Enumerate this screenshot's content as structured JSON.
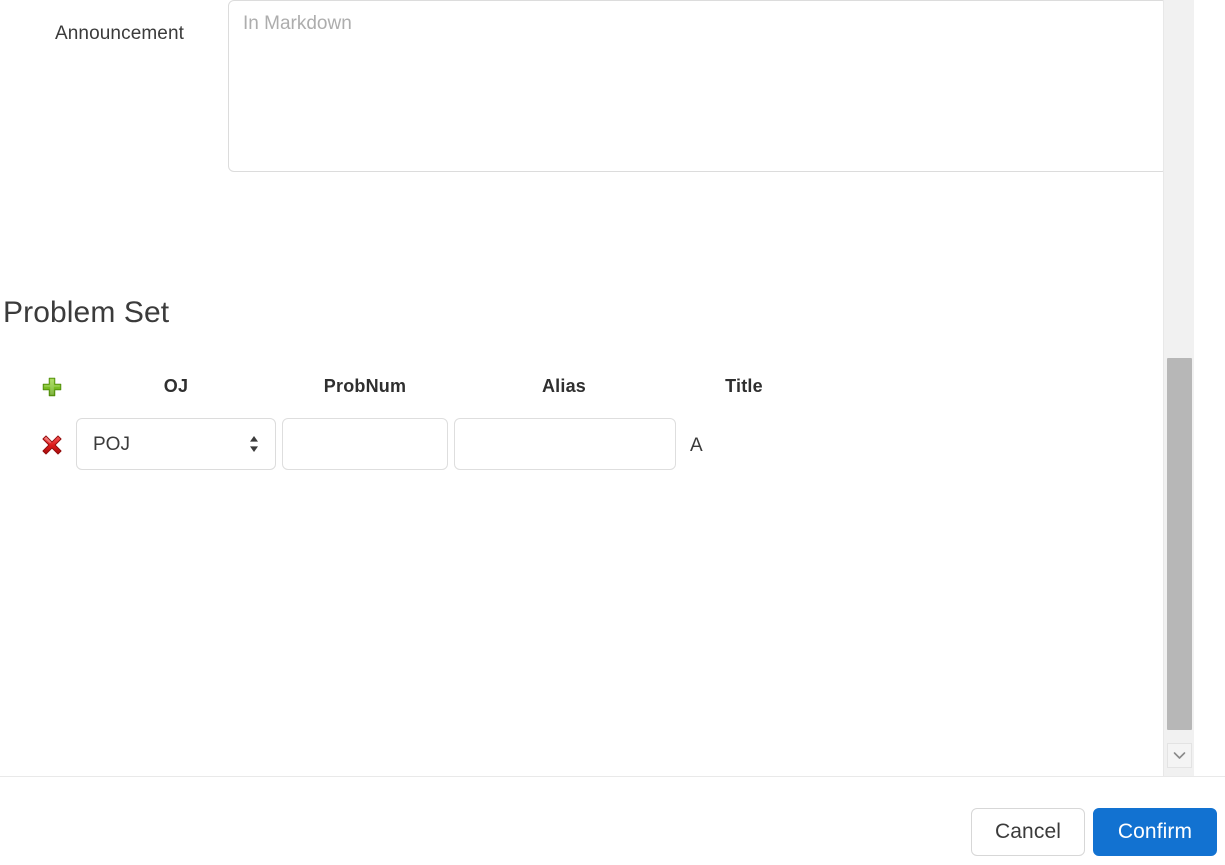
{
  "form": {
    "announcement": {
      "label": "Announcement",
      "placeholder": "In Markdown",
      "value": ""
    }
  },
  "problem_set": {
    "title": "Problem Set",
    "columns": {
      "oj": "OJ",
      "probnum": "ProbNum",
      "alias": "Alias",
      "title": "Title"
    },
    "add_icon": "plus-icon",
    "rows": [
      {
        "delete_icon": "red-x-icon",
        "oj": "POJ",
        "oj_options": [
          "POJ"
        ],
        "probnum": "",
        "alias": "",
        "title": "A"
      }
    ]
  },
  "scrollbar": {
    "down_icon": "chevron-down-icon"
  },
  "footer": {
    "cancel": "Cancel",
    "confirm": "Confirm"
  },
  "colors": {
    "confirm_bg": "#1272d1",
    "add_icon": "#76b72a",
    "delete_icon": "#e02020"
  }
}
